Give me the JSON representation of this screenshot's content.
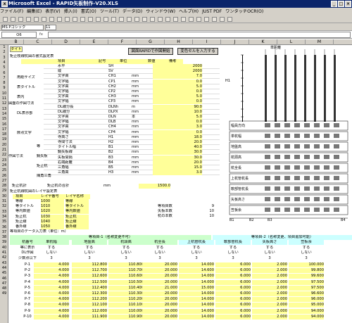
{
  "window": {
    "title": "Microsoft Excel - RAPID矢板制作-V20.XLS"
  },
  "menu": [
    "ファイル(F)",
    "編集(E)",
    "表示(V)",
    "挿入(I)",
    "書式(O)",
    "ツール(T)",
    "データ(D)",
    "ウィンドウ(W)",
    "ヘルプ(H)",
    "JUST PDF",
    "ワンタッチOCR(O)"
  ],
  "formula": {
    "font": "MS Pゴシック",
    "size": "11",
    "cell": "O6"
  },
  "columns": [
    "B",
    "C",
    "D",
    "E",
    "F",
    "G",
    "H",
    "I",
    "J",
    "K",
    "L",
    "M"
  ],
  "rows": [
    "1",
    "2",
    "3",
    "4",
    "5",
    "6",
    "7",
    "8",
    "9",
    "10",
    "11",
    "12",
    "13",
    "14",
    "15",
    "16",
    "17",
    "18",
    "19",
    "20",
    "21",
    "22",
    "23",
    "24",
    "25",
    "26",
    "27",
    "28",
    "29",
    "30",
    "31",
    "32",
    "33",
    "34",
    "35",
    "36",
    "37",
    "38",
    "39",
    "40",
    "41",
    "42",
    "43",
    "44",
    "45",
    "46",
    "47",
    "48",
    "49"
  ],
  "buttons": {
    "rapid": "図面RAPIDで作図開始",
    "select": "変色セルを入力する"
  },
  "title_label": "タイトル",
  "section1": "矩止枝線杭図の書式設定表",
  "header": {
    "item": "項目",
    "symbol": "記号",
    "unit": "単位",
    "value": "数値",
    "note": "備考"
  },
  "group_labels": {
    "size": "用紙サイズ",
    "title": "表タイトル",
    "table": "表内",
    "dl": "DL表示部",
    "node": "節点文字",
    "sheetpile": "鋼矢板",
    "drawing": "図面の作図寸法",
    "draw_size": "作図寸法",
    "hline": "等",
    "pile": "矩止杭",
    "anchor": "隅角三角"
  },
  "spec_rows": [
    [
      "水平",
      "SH",
      "",
      "2000"
    ],
    [
      "縦",
      "SV",
      "",
      "2000"
    ],
    [
      "文字高",
      "CH1",
      "mm",
      "7.0"
    ],
    [
      "文字幅",
      "CP1",
      "mm",
      "0.0"
    ],
    [
      "文字高",
      "CH2",
      "mm",
      "5.0"
    ],
    [
      "文字幅",
      "CP2",
      "mm",
      "0.0"
    ],
    [
      "文字高",
      "CH3",
      "mm",
      "5.0"
    ],
    [
      "文字幅",
      "CP3",
      "mm",
      "0.0"
    ],
    [
      "DL線分長",
      "DLNh",
      "m",
      "90.0"
    ],
    [
      "DL線分",
      "DLPX",
      "mm",
      "10.0"
    ],
    [
      "文字高",
      "DLN",
      "本",
      "5.0"
    ],
    [
      "文字幅",
      "DLB",
      "mm",
      "0.0"
    ],
    [
      "文字高",
      "CH4",
      "mm",
      "3.0"
    ],
    [
      "文字幅",
      "CP4",
      "mm",
      "0.0"
    ],
    [
      "寺高さ",
      "H1",
      "mm",
      "18.0"
    ],
    [
      "寺間寸法",
      "H2",
      "mm",
      "20.0"
    ],
    [
      "タイトル幅",
      "B1",
      "mm",
      "40.0"
    ],
    [
      "鋼矢板線",
      "B2",
      "mm",
      "30.0"
    ],
    [
      "矢板間隔",
      "B3",
      "mm",
      "30.0"
    ],
    [
      "右端距離",
      "B4",
      "mm",
      "20.0"
    ],
    [
      "三角幅",
      "B5",
      "mm",
      "15.0"
    ],
    [
      "三角高",
      "H3",
      "mm",
      "3.0"
    ]
  ],
  "anchor_total": {
    "label": "矩止杭計",
    "sub": "矩止杭の合計",
    "unit": "mm",
    "value": "1500.0"
  },
  "section2": "矩止杭線杭図のレイヤ設定表",
  "layer_header": {
    "item": "項目",
    "layer_no": "レイヤ番号",
    "layer_name": "レイヤ名称"
  },
  "layers": [
    [
      "等線",
      "1000",
      "等線"
    ],
    [
      "等タイトル",
      "1010",
      "等タイトル"
    ],
    [
      "等内数値",
      "1020",
      "等内数値"
    ],
    [
      "矩止杭",
      "1030",
      "矩止杭"
    ],
    [
      "矩止線",
      "1040",
      "矩止線"
    ],
    [
      "番外線",
      "1050",
      "番外線"
    ]
  ],
  "stats": [
    [
      "等項目数",
      "9"
    ],
    [
      "矢板本数",
      "10"
    ],
    [
      "杭の本数",
      "10"
    ]
  ],
  "section3": "等項目のデータ入力表（単位：m）",
  "data_group1": "等項目-1（名称変更不可）",
  "data_group2": "等項目-2（名称変更、項目追加可能）",
  "data_cols": [
    "杭番号",
    "単杭幅",
    "地盤高",
    "杭頭高",
    "杭全長",
    "上杭管杭長",
    "軟部管杭長",
    "矢板高さ",
    "笠板余"
  ],
  "data_rows2": [
    [
      "等に表示",
      "する",
      "する",
      "する",
      "する",
      "する",
      "する",
      "する",
      "する"
    ],
    [
      "DL作図",
      "しない",
      "しない",
      "しない",
      "しない",
      "しない",
      "しない",
      "しない",
      "しない"
    ],
    [
      "少数点以下",
      "3",
      "3",
      "3",
      "3",
      "3",
      "3",
      "3",
      "3"
    ]
  ],
  "data": [
    [
      "P-1",
      "4.000",
      "112.800",
      "110.800",
      "20.000",
      "14.000",
      "6.000",
      "2.000",
      "100.000"
    ],
    [
      "P-2",
      "4.000",
      "112.700",
      "110.700",
      "20.000",
      "14.600",
      "6.000",
      "2.000",
      "99.800"
    ],
    [
      "P-3",
      "4.000",
      "112.600",
      "110.600",
      "20.000",
      "14.000",
      "6.000",
      "2.000",
      "99.600"
    ],
    [
      "P-4",
      "4.000",
      "112.500",
      "110.500",
      "20.000",
      "14.000",
      "6.000",
      "2.000",
      "97.500"
    ],
    [
      "P-5",
      "4.000",
      "112.400",
      "110.400",
      "21.000",
      "15.000",
      "6.000",
      "2.000",
      "97.500"
    ],
    [
      "P-6",
      "4.000",
      "112.300",
      "110.300",
      "20.000",
      "14.000",
      "6.000",
      "2.000",
      "96.600"
    ],
    [
      "P-7",
      "4.000",
      "112.200",
      "110.200",
      "20.000",
      "14.000",
      "6.000",
      "2.000",
      "96.000"
    ],
    [
      "P-8",
      "4.000",
      "112.100",
      "110.100",
      "20.000",
      "14.000",
      "6.000",
      "2.000",
      "95.000"
    ],
    [
      "P-9",
      "4.000",
      "112.000",
      "110.000",
      "20.000",
      "14.000",
      "6.000",
      "2.000",
      "94.000"
    ],
    [
      "P-10",
      "4.000",
      "111.900",
      "110.900",
      "20.000",
      "14.000",
      "6.000",
      "2.000",
      "94.000"
    ]
  ],
  "diagram": {
    "label_b1": "B1",
    "label_b2": "B2",
    "label_b3": "B3",
    "label_b4": "B4",
    "label_h1": "H1",
    "label_h2": "H2",
    "label_top": "単距離",
    "row_labels": [
      "幅員方向",
      "単杭幅",
      "地盤高",
      "杭頭高",
      "杭全長",
      "上杭管杭長",
      "軟部管杭長",
      "矢板高さ",
      "笠板余"
    ]
  }
}
